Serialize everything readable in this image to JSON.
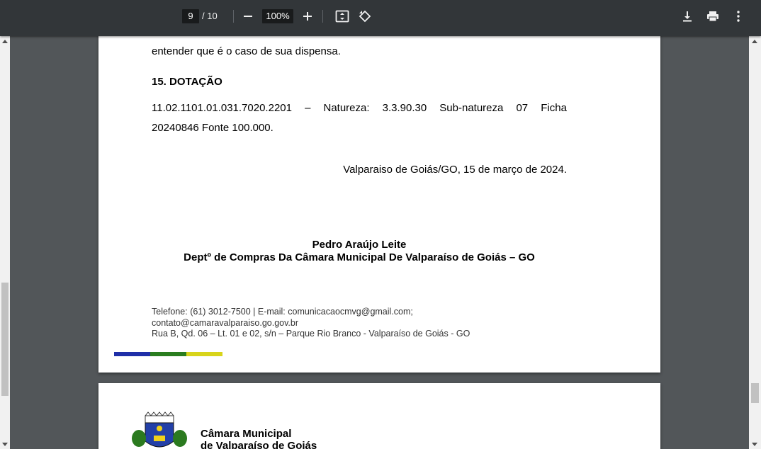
{
  "toolbar": {
    "page_current": "9",
    "page_total": "/ 10",
    "zoom": "100%",
    "icons": [
      "minus-icon",
      "plus-icon",
      "fit-page-icon",
      "rotate-icon",
      "download-icon",
      "print-icon",
      "more-vert-icon"
    ]
  },
  "page1": {
    "top_line": "entender que é o caso de sua dispensa.",
    "section_heading": "15.  DOTAÇÃO",
    "dotacao_line1": [
      "11.02.1101.01.031.7020.2201",
      "–",
      "Natureza:",
      "3.3.90.30",
      "Sub-natureza",
      "07",
      "Ficha"
    ],
    "dotacao_line2": "20240846 Fonte 100.000.",
    "date_line": "Valparaiso de Goiás/GO, 15 de março de 2024.",
    "signer_name": "Pedro Araújo Leite",
    "signer_dept": "Deptº de Compras Da Câmara Municipal De Valparaíso de Goiás – GO",
    "footer_line1": "Telefone: (61) 3012-7500 |  E-mail: comunicacaocmvg@gmail.com;",
    "footer_line2": "contato@camaravalparaiso.go.gov.br",
    "footer_line3": "Rua B, Qd. 06 – Lt. 01 e 02, s/n – Parque Rio Branco - Valparaíso de Goiás - GO",
    "bar_colors": [
      "#1f2fa8",
      "#2a7d1f",
      "#d8d41a"
    ]
  },
  "page2": {
    "org_line1": "Câmara Municipal",
    "org_line2": "de Valparaíso de Goiás"
  }
}
